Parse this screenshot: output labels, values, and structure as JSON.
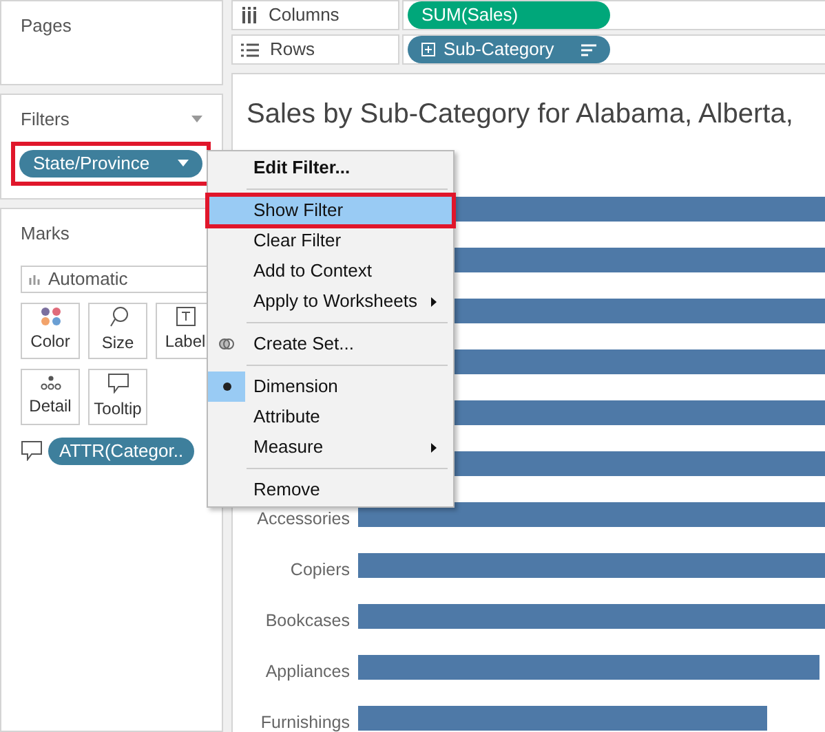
{
  "pages": {
    "title": "Pages"
  },
  "filters": {
    "title": "Filters",
    "pills": [
      {
        "label": "State/Province",
        "highlighted": true
      }
    ]
  },
  "marks": {
    "title": "Marks",
    "mark_type": "Automatic",
    "cards": [
      {
        "label": "Color",
        "kind": "color"
      },
      {
        "label": "Size",
        "kind": "size"
      },
      {
        "label": "Label",
        "kind": "label"
      },
      {
        "label": "Detail",
        "kind": "detail"
      },
      {
        "label": "Tooltip",
        "kind": "tooltip"
      }
    ],
    "fields": [
      {
        "label": "ATTR(Categor..",
        "kind": "tooltip"
      }
    ]
  },
  "shelves": [
    {
      "label": "Columns",
      "kind": "columns",
      "pill": "SUM(Sales)",
      "color": "#00a77a"
    },
    {
      "label": "Rows",
      "kind": "rows",
      "pill": "Sub-Category",
      "color": "#3e7f9c"
    }
  ],
  "view": {
    "title": "Sales by Sub-Category for Alabama, Alberta,",
    "categories": [
      "Accessories",
      "Copiers",
      "Bookcases",
      "Appliances",
      "Furnishings"
    ]
  },
  "context_menu": {
    "items": [
      {
        "kind": "item",
        "label": "Edit Filter...",
        "bold": true,
        "selected": false,
        "checked": false,
        "submenu": false,
        "highlighted": false
      },
      {
        "kind": "separator"
      },
      {
        "kind": "item",
        "label": "Show Filter",
        "bold": false,
        "selected": true,
        "checked": false,
        "submenu": false,
        "highlighted": true
      },
      {
        "kind": "item",
        "label": "Clear Filter",
        "bold": false,
        "selected": false,
        "checked": false,
        "submenu": false,
        "highlighted": false
      },
      {
        "kind": "item",
        "label": "Add to Context",
        "bold": false,
        "selected": false,
        "checked": false,
        "submenu": false,
        "highlighted": false
      },
      {
        "kind": "item",
        "label": "Apply to Worksheets",
        "bold": false,
        "selected": false,
        "checked": false,
        "submenu": true,
        "highlighted": false
      },
      {
        "kind": "separator"
      },
      {
        "kind": "set",
        "label": "Create Set...",
        "bold": false,
        "selected": false,
        "checked": false,
        "submenu": false,
        "highlighted": false
      },
      {
        "kind": "separator"
      },
      {
        "kind": "item",
        "label": "Dimension",
        "bold": false,
        "selected": false,
        "checked": true,
        "submenu": false,
        "highlighted": false
      },
      {
        "kind": "item",
        "label": "Attribute",
        "bold": false,
        "selected": false,
        "checked": false,
        "submenu": false,
        "highlighted": false
      },
      {
        "kind": "item",
        "label": "Measure",
        "bold": false,
        "selected": false,
        "checked": false,
        "submenu": true,
        "highlighted": false
      },
      {
        "kind": "separator"
      },
      {
        "kind": "item",
        "label": "Remove",
        "bold": false,
        "selected": false,
        "checked": false,
        "submenu": false,
        "highlighted": false
      }
    ]
  }
}
